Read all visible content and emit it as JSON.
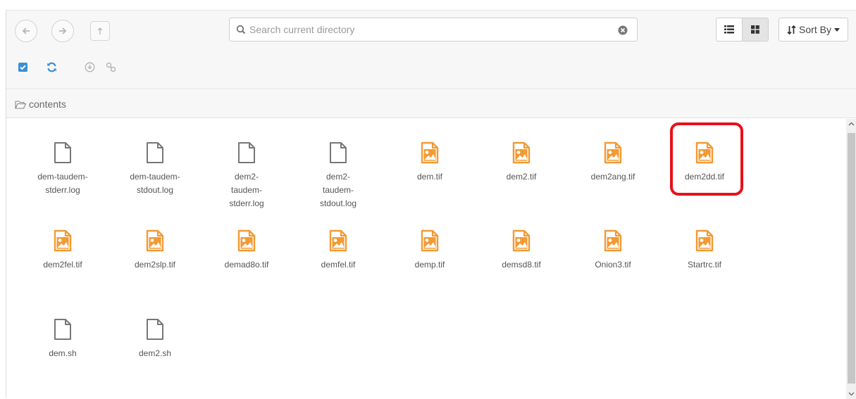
{
  "toolbar": {
    "search_placeholder": "Search current directory",
    "sort_label": "Sort By"
  },
  "breadcrumb": {
    "label": "contents"
  },
  "files": [
    {
      "name": "dem-taudem-stderr.log",
      "lines": [
        "dem-taudem-",
        "stderr.log"
      ],
      "type": "doc"
    },
    {
      "name": "dem-taudem-stdout.log",
      "lines": [
        "dem-taudem-",
        "stdout.log"
      ],
      "type": "doc"
    },
    {
      "name": "dem2-taudem-stderr.log",
      "lines": [
        "dem2-",
        "taudem-",
        "stderr.log"
      ],
      "type": "doc"
    },
    {
      "name": "dem2-taudem-stdout.log",
      "lines": [
        "dem2-",
        "taudem-",
        "stdout.log"
      ],
      "type": "doc"
    },
    {
      "name": "dem.tif",
      "lines": [
        "dem.tif"
      ],
      "type": "image"
    },
    {
      "name": "dem2.tif",
      "lines": [
        "dem2.tif"
      ],
      "type": "image"
    },
    {
      "name": "dem2ang.tif",
      "lines": [
        "dem2ang.tif"
      ],
      "type": "image"
    },
    {
      "name": "dem2dd.tif",
      "lines": [
        "dem2dd.tif"
      ],
      "type": "image"
    },
    {
      "name": "dem2fel.tif",
      "lines": [
        "dem2fel.tif"
      ],
      "type": "image"
    },
    {
      "name": "dem2slp.tif",
      "lines": [
        "dem2slp.tif"
      ],
      "type": "image"
    },
    {
      "name": "demad8o.tif",
      "lines": [
        "demad8o.tif"
      ],
      "type": "image"
    },
    {
      "name": "demfel.tif",
      "lines": [
        "demfel.tif"
      ],
      "type": "image"
    },
    {
      "name": "demp.tif",
      "lines": [
        "demp.tif"
      ],
      "type": "image"
    },
    {
      "name": "demsd8.tif",
      "lines": [
        "demsd8.tif"
      ],
      "type": "image"
    },
    {
      "name": "Onion3.tif",
      "lines": [
        "Onion3.tif"
      ],
      "type": "image"
    },
    {
      "name": "Startrc.tif",
      "lines": [
        "Startrc.tif"
      ],
      "type": "image"
    },
    {
      "name": "dem.sh",
      "lines": [
        "dem.sh"
      ],
      "type": "doc"
    },
    {
      "name": "dem2.sh",
      "lines": [
        "dem2.sh"
      ],
      "type": "doc"
    }
  ],
  "colors": {
    "accent": "#3a8fd6",
    "image_icon": "#f39a33",
    "highlight": "#e8111b"
  },
  "icons": {
    "back": "arrow-left-icon",
    "forward": "arrow-right-icon",
    "up": "level-up-icon",
    "select_all": "checkbox-icon",
    "refresh": "refresh-icon",
    "download": "download-icon",
    "link": "link-icon",
    "search": "search-icon",
    "clear": "clear-icon",
    "list_view": "list-view-icon",
    "grid_view": "grid-view-icon",
    "sort": "sort-icon",
    "folder": "folder-open-icon"
  }
}
